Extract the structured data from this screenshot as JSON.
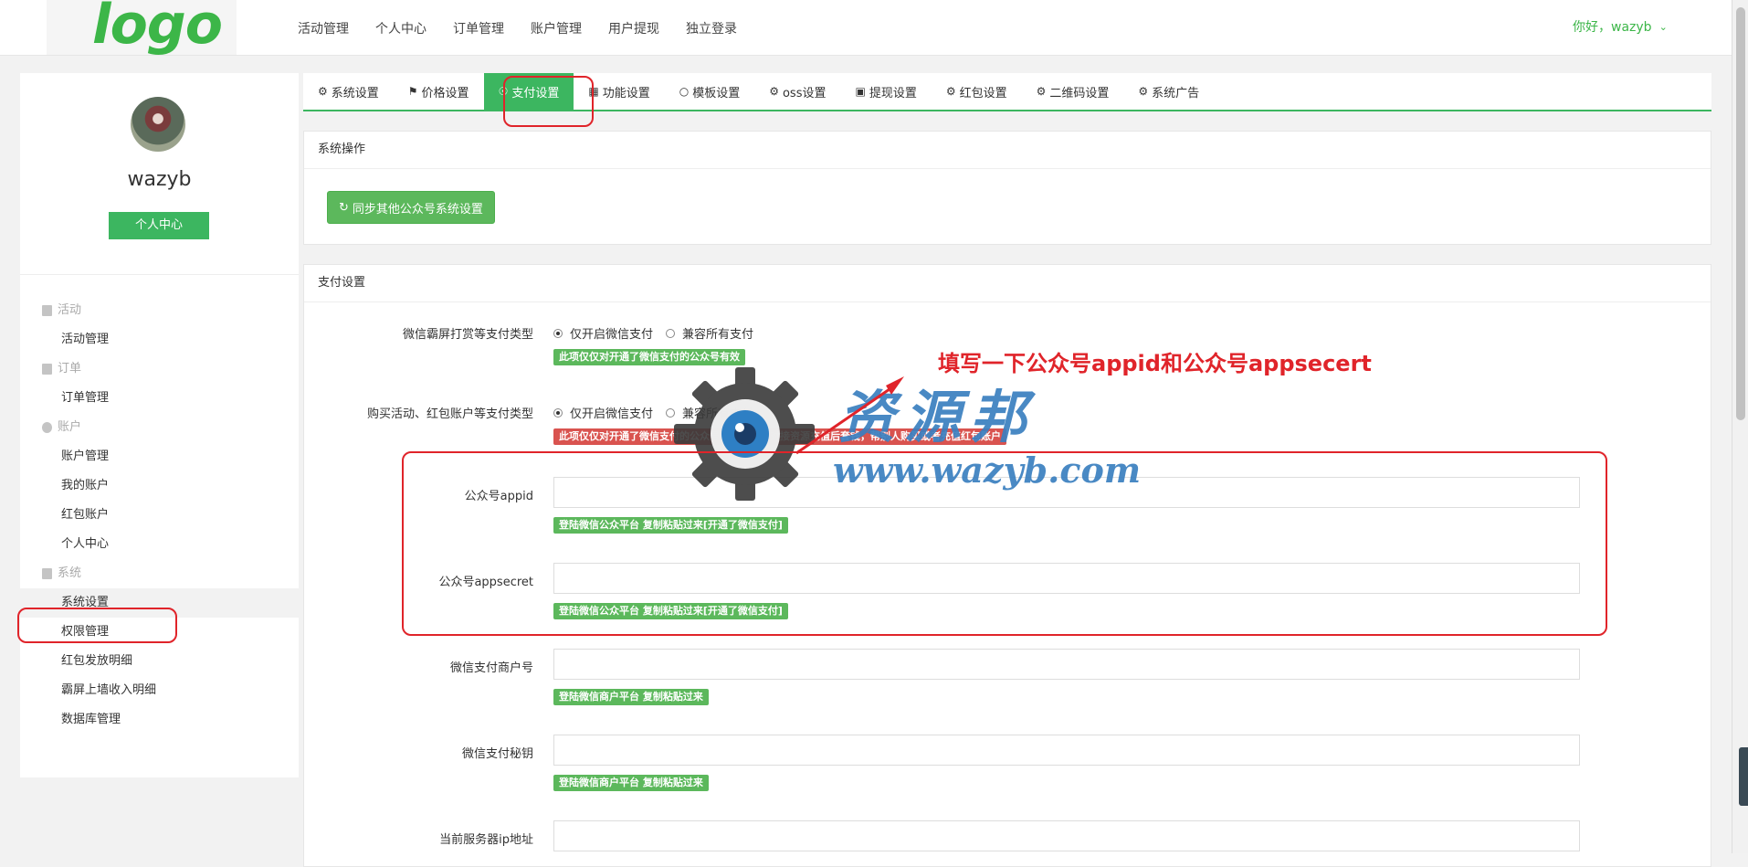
{
  "brand": {
    "logo_text": "logo"
  },
  "topnav": [
    "活动管理",
    "个人中心",
    "订单管理",
    "账户管理",
    "用户提现",
    "独立登录"
  ],
  "user": {
    "greeting": "你好，wazyb"
  },
  "sidebar": {
    "username": "wazyb",
    "profile_button": "个人中心",
    "groups": [
      {
        "title": "活动",
        "items": [
          "活动管理"
        ]
      },
      {
        "title": "订单",
        "items": [
          "订单管理"
        ]
      },
      {
        "title": "账户",
        "items": [
          "账户管理",
          "我的账户",
          "红包账户",
          "个人中心"
        ]
      },
      {
        "title": "系统",
        "items": [
          "系统设置",
          "权限管理",
          "红包发放明细",
          "霸屏上墙收入明细",
          "数据库管理"
        ]
      }
    ],
    "active_item": "系统设置"
  },
  "tabs": [
    {
      "icon": "gear-icon",
      "label": "系统设置"
    },
    {
      "icon": "tag-icon",
      "label": "价格设置"
    },
    {
      "icon": "payment-icon",
      "label": "支付设置"
    },
    {
      "icon": "calendar-icon",
      "label": "功能设置"
    },
    {
      "icon": "circle-icon",
      "label": "模板设置"
    },
    {
      "icon": "gear-icon",
      "label": "oss设置"
    },
    {
      "icon": "money-icon",
      "label": "提现设置"
    },
    {
      "icon": "gear-icon",
      "label": "红包设置"
    },
    {
      "icon": "gear-icon",
      "label": "二维码设置"
    },
    {
      "icon": "gear-icon",
      "label": "系统广告"
    }
  ],
  "active_tab": "支付设置",
  "system_panel": {
    "title": "系统操作",
    "sync_button": "同步其他公众号系统设置"
  },
  "pay_panel": {
    "title": "支付设置",
    "wechat_screen_type": {
      "label": "微信霸屏打赏等支付类型",
      "options": [
        "仅开启微信支付",
        "兼容所有支付"
      ],
      "selected": "仅开启微信支付",
      "hint": "此项仅仅对开通了微信支付的公众号有效"
    },
    "purchase_type": {
      "label": "购买活动、红包账户等支付类型",
      "options": [
        "仅开启微信支付",
        "兼容所有支付"
      ],
      "selected": "仅开启微信支付",
      "hint": "此项仅仅对开通了微信支付的公众号有效，防止对接资源充值后套钱，帮别人购买或者充值红包账户"
    },
    "appid": {
      "label": "公众号appid",
      "value": "",
      "hint": "登陆微信公众平台 复制粘贴过来[开通了微信支付]"
    },
    "appsecret": {
      "label": "公众号appsecret",
      "value": "",
      "hint": "登陆微信公众平台 复制粘贴过来[开通了微信支付]"
    },
    "mch_id": {
      "label": "微信支付商户号",
      "value": "",
      "hint": "登陆微信商户平台 复制粘贴过来"
    },
    "mch_key": {
      "label": "微信支付秘钥",
      "value": "",
      "hint": "登陆微信商户平台 复制粘贴过来"
    },
    "server_ip": {
      "label": "当前服务器ip地址",
      "value": ""
    }
  },
  "annotation": {
    "text": "填写一下公众号appid和公众号appsecert",
    "color": "#e0242a"
  },
  "watermark": {
    "cn": "资源邦",
    "url": "www.wazyb.com",
    "color": "#3a7fc0"
  },
  "colors": {
    "accent": "#3cb660",
    "logo": "#3cb648"
  }
}
